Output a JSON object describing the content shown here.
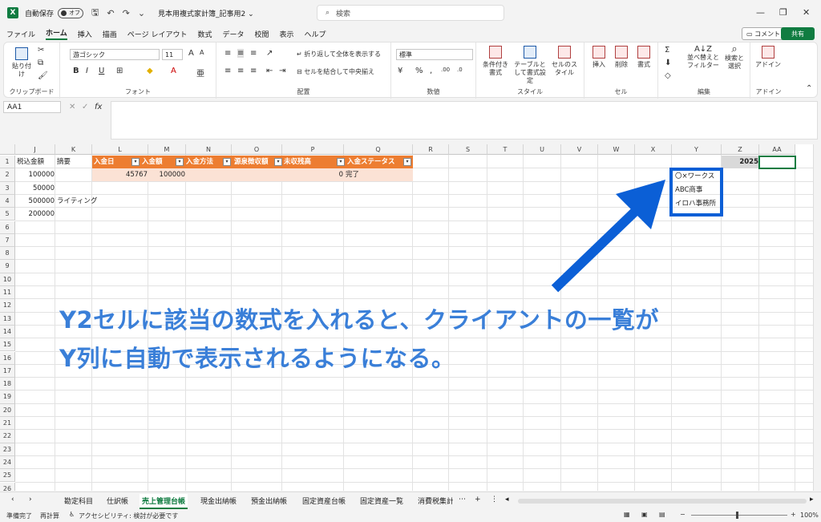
{
  "titlebar": {
    "app_icon": "X",
    "autosave_label": "自動保存",
    "toggle_label": "オフ",
    "doc_title": "見本用複式家計簿_記事用2 ⌄",
    "search_placeholder": "検索"
  },
  "menu": [
    "ファイル",
    "ホーム",
    "挿入",
    "描画",
    "ページ レイアウト",
    "数式",
    "データ",
    "校閲",
    "表示",
    "ヘルプ"
  ],
  "menu_active": "ホーム",
  "comment_label": "コメント",
  "share_label": "共有",
  "ribbon": {
    "clipboard": {
      "paste": "貼り付け",
      "label": "クリップボード"
    },
    "font": {
      "name": "游ゴシック",
      "size": "11",
      "label": "フォント"
    },
    "align": {
      "wrap": "折り返して全体を表示する",
      "merge": "セルを結合して中央揃え",
      "label": "配置"
    },
    "number": {
      "format": "標準",
      "label": "数値"
    },
    "style": {
      "conditional": "条件付き書式",
      "table": "テーブルとして書式設定",
      "cell_style": "セルのスタイル",
      "label": "スタイル"
    },
    "cells": {
      "insert": "挿入",
      "delete": "削除",
      "format": "書式",
      "label": "セル"
    },
    "edit": {
      "sort": "並べ替えとフィルター",
      "find": "検索と選択",
      "label": "編集"
    },
    "addin": {
      "addin": "アドイン",
      "label": "アドイン"
    }
  },
  "namebox": "AA1",
  "columns": [
    "J",
    "K",
    "L",
    "M",
    "N",
    "O",
    "P",
    "Q",
    "R",
    "S",
    "T",
    "U",
    "V",
    "W",
    "X",
    "Y",
    "Z",
    "AA"
  ],
  "rows": [
    "1",
    "2",
    "3",
    "4",
    "5",
    "6",
    "7",
    "8",
    "9",
    "10",
    "11",
    "12",
    "13",
    "14",
    "15",
    "16",
    "17",
    "18",
    "19",
    "20",
    "21",
    "22",
    "23",
    "24",
    "25",
    "26"
  ],
  "cells": {
    "j1": "税込金額",
    "k1": "摘要",
    "j2": "100000",
    "j3": "50000",
    "j4": "500000",
    "k4": "ライティング",
    "j5": "200000",
    "l2": "45767",
    "m2": "100000",
    "p2": "0",
    "q2": "完了",
    "z1": "2025"
  },
  "table_headers": [
    "入金日",
    "入金額",
    "入金方法",
    "源泉徴収額",
    "未収残高",
    "入金ステータス"
  ],
  "clients": [
    "〇×ワークス",
    "ABC商事",
    "イロハ事務所"
  ],
  "caption": [
    "Y2セルに該当の数式を入れると、クライアントの一覧が",
    "Y列に自動で表示されるようになる。"
  ],
  "sheets": [
    "勘定科目",
    "仕訳帳",
    "売上管理台帳",
    "現金出納帳",
    "預金出納帳",
    "固定資産台帳",
    "固定資産一覧",
    "消費税集計"
  ],
  "sheet_active": "売上管理台帳",
  "status": {
    "ready": "準備完了",
    "recalc": "再計算",
    "access": "アクセシビリティ: 検討が必要です",
    "zoom": "100%"
  },
  "colors": {
    "accent": "#107c41",
    "table_header": "#ed7d31",
    "table_row": "#fbe2d5",
    "highlight": "#0b5fd6",
    "caption": "#3a7fd8"
  }
}
